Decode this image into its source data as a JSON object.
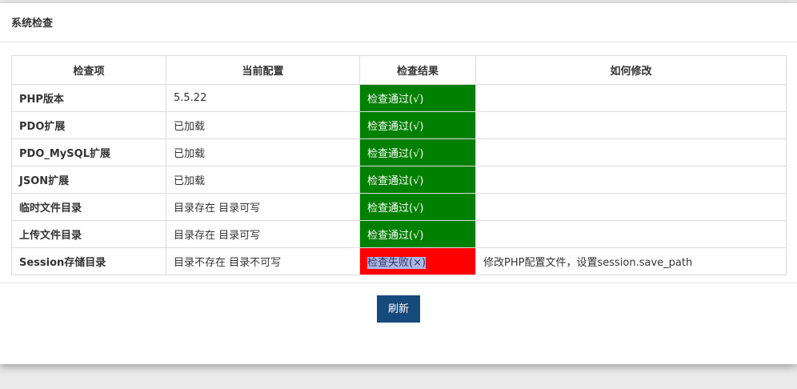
{
  "panel": {
    "title": "系统检查",
    "refresh_label": "刷新"
  },
  "table": {
    "headers": [
      "检查项",
      "当前配置",
      "检查结果",
      "如何修改"
    ],
    "rows": [
      {
        "item": "PHP版本",
        "config": "5.5.22",
        "result": "检查通过(√)",
        "status": "pass",
        "fix": ""
      },
      {
        "item": "PDO扩展",
        "config": "已加载",
        "result": "检查通过(√)",
        "status": "pass",
        "fix": ""
      },
      {
        "item": "PDO_MySQL扩展",
        "config": "已加载",
        "result": "检查通过(√)",
        "status": "pass",
        "fix": ""
      },
      {
        "item": "JSON扩展",
        "config": "已加载",
        "result": "检查通过(√)",
        "status": "pass",
        "fix": ""
      },
      {
        "item": "临时文件目录",
        "config": "目录存在 目录可写",
        "result": "检查通过(√)",
        "status": "pass",
        "fix": ""
      },
      {
        "item": "上传文件目录",
        "config": "目录存在 目录可写",
        "result": "检查通过(√)",
        "status": "pass",
        "fix": ""
      },
      {
        "item": "Session存储目录",
        "config": "目录不存在 目录不可写",
        "result": "检查失败(×)",
        "status": "fail",
        "fix": "修改PHP配置文件，设置session.save_path"
      }
    ]
  },
  "colors": {
    "pass": "#008000",
    "fail": "#ff0000",
    "button": "#174a7c",
    "selection": "#aab8e8"
  }
}
